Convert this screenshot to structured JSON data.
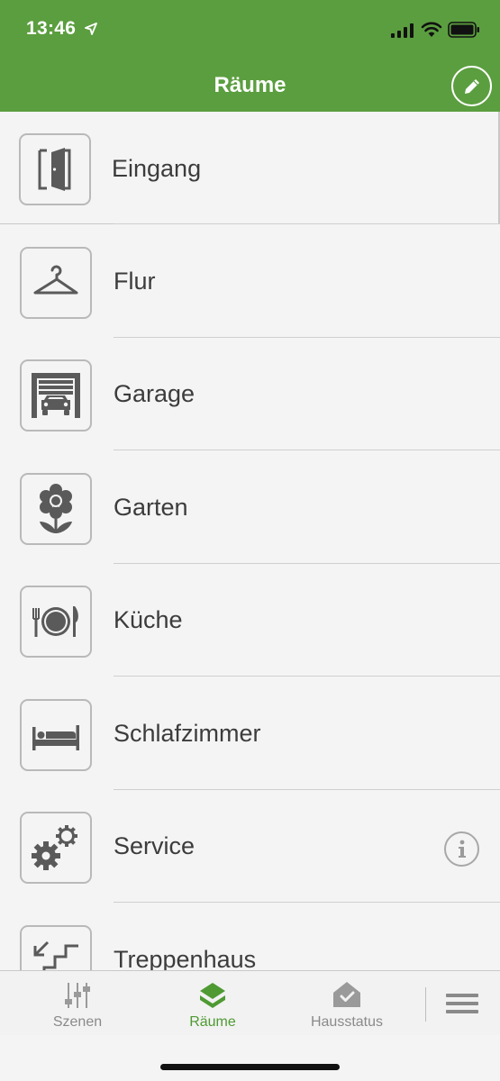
{
  "status_bar": {
    "time": "13:46"
  },
  "header": {
    "title": "Räume"
  },
  "rooms": [
    {
      "label": "Eingang",
      "icon": "door-icon"
    },
    {
      "label": "Flur",
      "icon": "hanger-icon"
    },
    {
      "label": "Garage",
      "icon": "garage-icon"
    },
    {
      "label": "Garten",
      "icon": "flower-icon"
    },
    {
      "label": "Küche",
      "icon": "plate-cutlery-icon"
    },
    {
      "label": "Schlafzimmer",
      "icon": "bed-icon"
    },
    {
      "label": "Service",
      "icon": "gears-icon"
    },
    {
      "label": "Treppenhaus",
      "icon": "stairs-icon"
    }
  ],
  "tabs": [
    {
      "label": "Szenen",
      "icon": "sliders-icon",
      "active": false
    },
    {
      "label": "Räume",
      "icon": "house-layers-icon",
      "active": true
    },
    {
      "label": "Hausstatus",
      "icon": "house-check-icon",
      "active": false
    }
  ],
  "colors": {
    "header_green": "#5b9e3f",
    "active_tab_green": "#4f9a33",
    "icon_gray": "#5a5a5a",
    "background": "#f4f4f4"
  }
}
